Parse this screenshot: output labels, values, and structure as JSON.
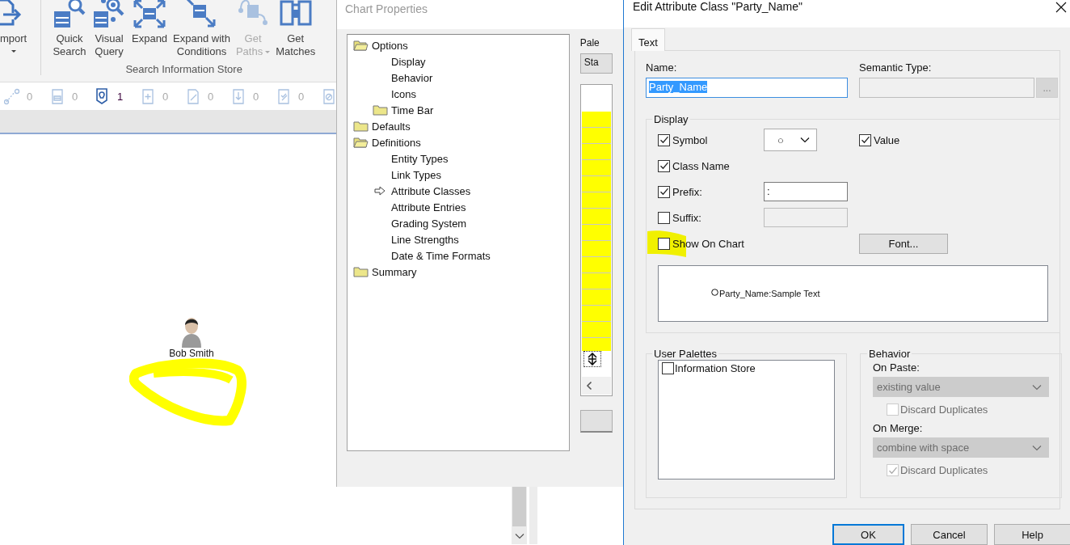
{
  "app": {
    "ribbon": {
      "buttons": [
        {
          "lines": [
            "mport"
          ],
          "disabled": false,
          "dropdown": true
        },
        {
          "lines": [
            "Quick",
            "Search"
          ],
          "disabled": false,
          "dropdown": false
        },
        {
          "lines": [
            "Visual",
            "Query"
          ],
          "disabled": false,
          "dropdown": false
        },
        {
          "lines": [
            "Expand"
          ],
          "disabled": false,
          "dropdown": false
        },
        {
          "lines": [
            "Expand with",
            "Conditions"
          ],
          "disabled": false,
          "dropdown": false
        },
        {
          "lines": [
            "Get",
            "Paths"
          ],
          "disabled": true,
          "dropdown": true
        },
        {
          "lines": [
            "Get",
            "Matches"
          ],
          "disabled": false,
          "dropdown": false
        }
      ],
      "group_label": "Search Information Store"
    },
    "counters": [
      {
        "value": "0",
        "active": false
      },
      {
        "value": "0",
        "active": false
      },
      {
        "value": "1",
        "active": true
      },
      {
        "value": "0",
        "active": false
      },
      {
        "value": "0",
        "active": false
      },
      {
        "value": "0",
        "active": false
      },
      {
        "value": "0",
        "active": false
      },
      {
        "active": false
      }
    ],
    "canvas": {
      "nodes": [
        {
          "label": "Bob Smith"
        }
      ]
    }
  },
  "chart_properties": {
    "title": "Chart Properties",
    "tree": [
      {
        "label": "Options",
        "kind": "folder",
        "expanded": true,
        "selected": false,
        "children": [
          {
            "label": "Display",
            "kind": "page",
            "selected": false
          },
          {
            "label": "Behavior",
            "kind": "page",
            "selected": false
          },
          {
            "label": "Icons",
            "kind": "page",
            "selected": false
          },
          {
            "label": "Time Bar",
            "kind": "folder",
            "expanded": false,
            "selected": false
          }
        ]
      },
      {
        "label": "Defaults",
        "kind": "folder",
        "expanded": false,
        "selected": false
      },
      {
        "label": "Definitions",
        "kind": "folder",
        "expanded": true,
        "selected": false,
        "children": [
          {
            "label": "Entity Types",
            "kind": "page",
            "selected": false
          },
          {
            "label": "Link Types",
            "kind": "page",
            "selected": false
          },
          {
            "label": "Attribute Classes",
            "kind": "page",
            "selected": true
          },
          {
            "label": "Attribute Entries",
            "kind": "page",
            "selected": false
          },
          {
            "label": "Grading System",
            "kind": "page",
            "selected": false
          },
          {
            "label": "Line Strengths",
            "kind": "page",
            "selected": false
          },
          {
            "label": "Date & Time Formats",
            "kind": "page",
            "selected": false
          }
        ]
      },
      {
        "label": "Summary",
        "kind": "folder",
        "expanded": false,
        "selected": false
      }
    ],
    "palette_label": "Pale",
    "palette_value": "Sta"
  },
  "edit_dialog": {
    "title": "Edit Attribute Class \"Party_Name\"",
    "tabs": [
      {
        "label": "Text",
        "selected": true
      }
    ],
    "name": {
      "label": "Name:",
      "value": "Party_Name",
      "value_selected": true
    },
    "semantic_type": {
      "label": "Semantic Type:",
      "button": "..."
    },
    "display": {
      "legend": "Display",
      "options": [
        {
          "label": "Symbol",
          "checked": true,
          "kind": "dropdown",
          "value": "○"
        },
        {
          "label": "Class Name",
          "checked": true,
          "kind": "plain"
        },
        {
          "label": "Prefix:",
          "checked": true,
          "kind": "field",
          "value": ":",
          "disabled": false
        },
        {
          "label": "Suffix:",
          "checked": false,
          "kind": "field",
          "disabled": true
        },
        {
          "label": "Show On Chart",
          "checked": false,
          "kind": "plain"
        }
      ],
      "value_option": {
        "label": "Value",
        "checked": true
      },
      "font_button": "Font...",
      "preview": "Party_Name:Sample Text"
    },
    "user_palettes": {
      "legend": "User Palettes",
      "items": [
        {
          "label": "Information Store",
          "checked": false
        }
      ]
    },
    "behavior": {
      "legend": "Behavior",
      "on_paste": {
        "label": "On Paste:",
        "value": "existing value",
        "disabled": true,
        "discard": {
          "label": "Discard Duplicates",
          "checked": false,
          "disabled": true
        }
      },
      "on_merge": {
        "label": "On Merge:",
        "value": "combine with space",
        "disabled": true,
        "discard": {
          "label": "Discard Duplicates",
          "checked": true,
          "disabled": true
        }
      }
    },
    "buttons": [
      {
        "label": "OK",
        "default": true
      },
      {
        "label": "Cancel",
        "default": false
      },
      {
        "label": "Help",
        "default": false
      }
    ]
  }
}
